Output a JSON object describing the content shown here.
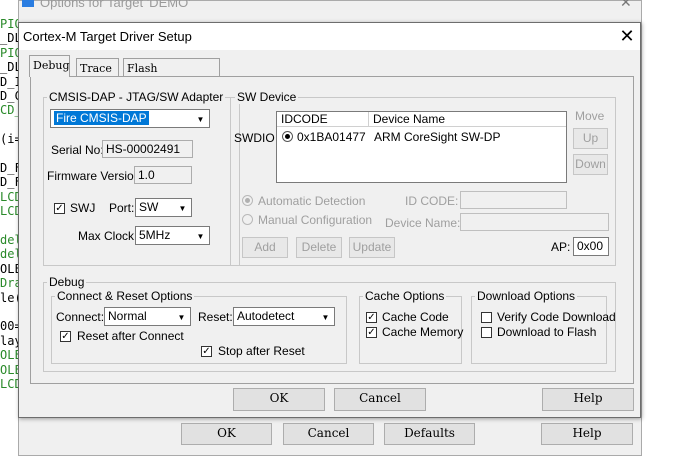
{
  "background_editor": {
    "lines": [
      {
        "text": "PIO",
        "color": "#2a8a2a"
      },
      {
        "text": "_DL",
        "color": "#000000"
      },
      {
        "text": "PIO",
        "color": "#2a8a2a"
      },
      {
        "text": "_DL",
        "color": "#000000"
      },
      {
        "text": "D_I",
        "color": "#000000"
      },
      {
        "text": "D_C",
        "color": "#000000"
      },
      {
        "text": "CD_",
        "color": "#2a8a2a"
      },
      {
        "text": "",
        "color": "#000000"
      },
      {
        "text": "(i=",
        "color": "#000000"
      },
      {
        "text": "",
        "color": "#000000"
      },
      {
        "text": "D_F",
        "color": "#000000"
      },
      {
        "text": "D_F",
        "color": "#000000"
      },
      {
        "text": "LCD",
        "color": "#2a8a2a"
      },
      {
        "text": "LCD",
        "color": "#2a8a2a"
      },
      {
        "text": "",
        "color": "#000000"
      },
      {
        "text": "del",
        "color": "#2a8a2a"
      },
      {
        "text": "del",
        "color": "#2a8a2a"
      },
      {
        "text": "OLE",
        "color": "#000000"
      },
      {
        "text": "Dra",
        "color": "#2a8a2a"
      },
      {
        "text": "le(",
        "color": "#000000"
      },
      {
        "text": "",
        "color": "#000000"
      },
      {
        "text": "00=",
        "color": "#000000"
      },
      {
        "text": "lay",
        "color": "#000000"
      },
      {
        "text": "OLE",
        "color": "#2a8a2a"
      },
      {
        "text": "OLE",
        "color": "#2a8a2a"
      },
      {
        "text": "LCD",
        "color": "#2a8a2a"
      }
    ]
  },
  "back_window": {
    "title": "Options for Target 'DEMO'",
    "buttons": {
      "ok": "OK",
      "cancel": "Cancel",
      "defaults": "Defaults",
      "help": "Help"
    }
  },
  "dialog": {
    "title": "Cortex-M Target Driver Setup",
    "tabs": [
      {
        "label": "Debug",
        "active": true
      },
      {
        "label": "Trace",
        "active": false
      },
      {
        "label": "Flash Download",
        "active": false
      }
    ],
    "adapter": {
      "group_label": "CMSIS-DAP - JTAG/SW Adapter",
      "selected_adapter": "Fire CMSIS-DAP",
      "serial_label": "Serial No:",
      "serial_value": "HS-00002491",
      "firmware_label": "Firmware Version:",
      "firmware_value": "1.0",
      "swj_label": "SWJ",
      "swj_checked": true,
      "port_label": "Port:",
      "port_value": "SW",
      "clock_label": "Max Clock:",
      "clock_value": "5MHz"
    },
    "sw_device": {
      "group_label": "SW Device",
      "row_label": "SWDIO",
      "col_idcode": "IDCODE",
      "col_device_name": "Device Name",
      "rows": [
        {
          "idcode": "0x1BA01477",
          "device_name": "ARM CoreSight SW-DP"
        }
      ],
      "move_label": "Move",
      "up_label": "Up",
      "down_label": "Down",
      "auto_detect_label": "Automatic Detection",
      "manual_config_label": "Manual Configuration",
      "id_code_label": "ID CODE:",
      "device_name_label": "Device Name:",
      "add_label": "Add",
      "delete_label": "Delete",
      "update_label": "Update",
      "ap_label": "AP:",
      "ap_value": "0x00"
    },
    "debug": {
      "group_label": "Debug",
      "connect_reset": {
        "group_label": "Connect & Reset Options",
        "connect_label": "Connect:",
        "connect_value": "Normal",
        "reset_label": "Reset:",
        "reset_value": "Autodetect",
        "reset_after_connect_label": "Reset after Connect",
        "reset_after_connect_checked": true,
        "stop_after_reset_label": "Stop after Reset",
        "stop_after_reset_checked": true
      },
      "cache": {
        "group_label": "Cache Options",
        "cache_code_label": "Cache Code",
        "cache_code_checked": true,
        "cache_memory_label": "Cache Memory",
        "cache_memory_checked": true
      },
      "download": {
        "group_label": "Download Options",
        "verify_label": "Verify Code Download",
        "verify_checked": false,
        "download_flash_label": "Download to Flash",
        "download_flash_checked": false
      }
    },
    "buttons": {
      "ok": "OK",
      "cancel": "Cancel",
      "help": "Help"
    }
  },
  "glyphs": {
    "close": "✕",
    "combo_arrow": "▼",
    "check": "✓"
  },
  "colors": {
    "selection": "#0078d7",
    "dialog_bg": "#f0f0f0"
  }
}
